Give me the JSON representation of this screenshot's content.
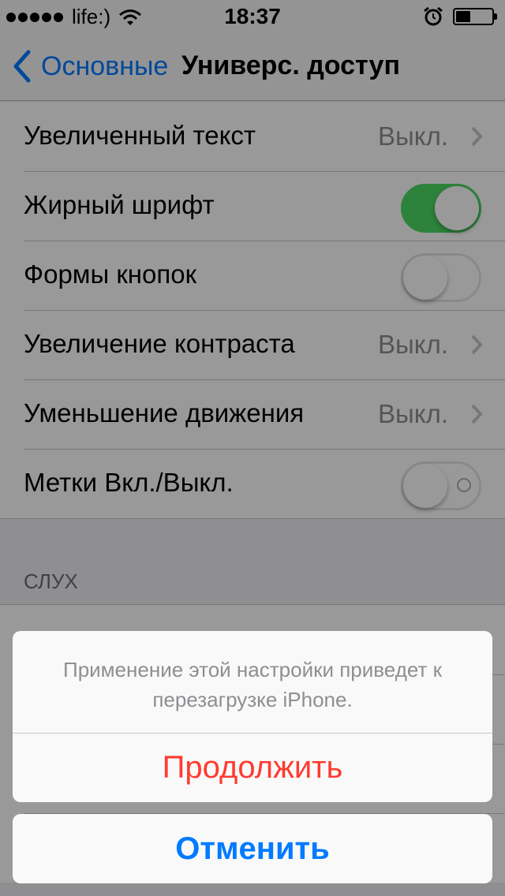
{
  "status_bar": {
    "carrier": "life:)",
    "time": "18:37",
    "icons": [
      "signal-dots-icon",
      "wifi-icon",
      "alarm-icon",
      "battery-icon"
    ]
  },
  "nav": {
    "back_label": "Основные",
    "title": "Универс. доступ"
  },
  "settings": {
    "rows": [
      {
        "label": "Увеличенный текст",
        "value": "Выкл.",
        "type": "disclosure"
      },
      {
        "label": "Жирный шрифт",
        "type": "toggle",
        "on": true
      },
      {
        "label": "Формы кнопок",
        "type": "toggle",
        "on": false
      },
      {
        "label": "Увеличение контраста",
        "value": "Выкл.",
        "type": "disclosure"
      },
      {
        "label": "Уменьшение движения",
        "value": "Выкл.",
        "type": "disclosure"
      },
      {
        "label": "Метки Вкл./Выкл.",
        "type": "toggle",
        "on": false
      }
    ],
    "section_header": "СЛУХ"
  },
  "action_sheet": {
    "message": "Применение этой настройки приведет к перезагрузке iPhone.",
    "continue_label": "Продолжить",
    "cancel_label": "Отменить"
  },
  "colors": {
    "accent": "#007aff",
    "destructive": "#ff3b30",
    "toggle_on": "#4cd964"
  }
}
